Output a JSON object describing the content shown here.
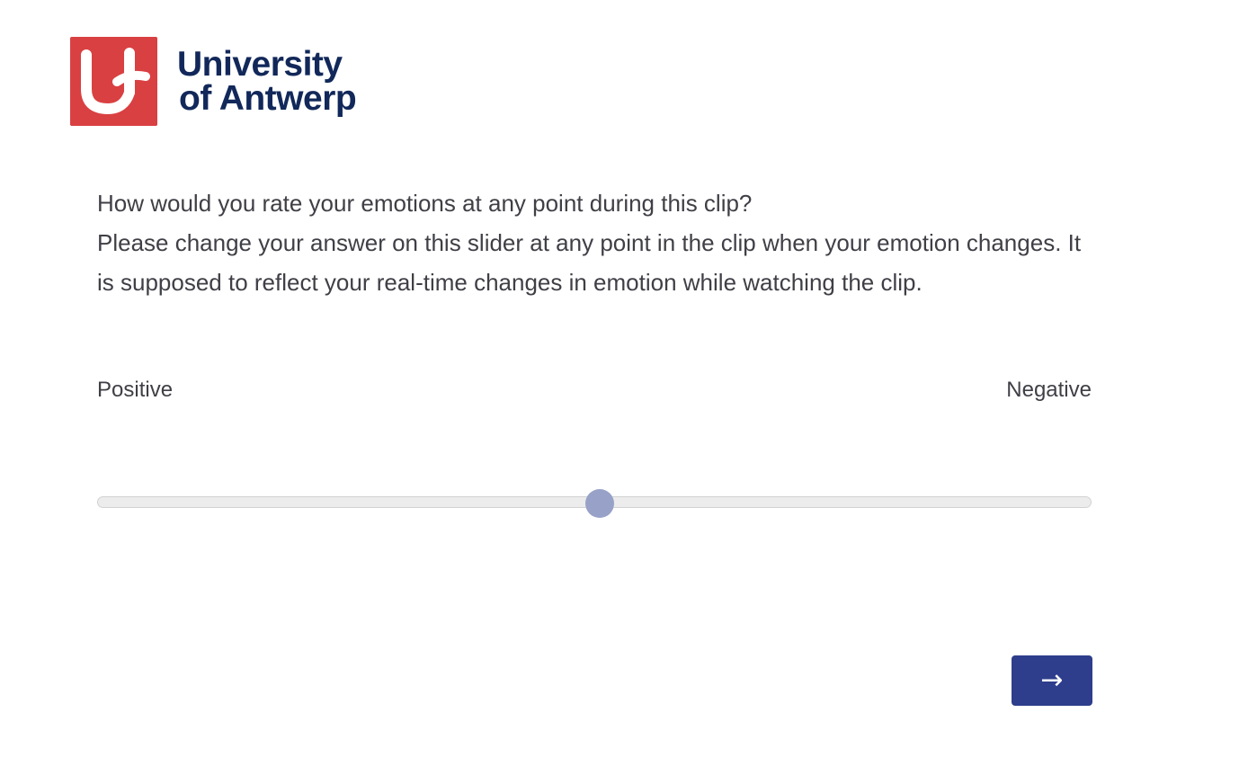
{
  "logo": {
    "line1": "University",
    "line2": "of Antwerp",
    "mark_color": "#d94042",
    "text_color": "#12285a"
  },
  "question": {
    "line1": "How would you rate your emotions at any point during this clip?",
    "line2": "Please change your answer on this slider at any point in the clip when your emotion changes. It is supposed to reflect your real-time changes in emotion while watching the clip."
  },
  "slider": {
    "left_label": "Positive",
    "right_label": "Negative",
    "value_fraction": 0.505,
    "handle_color": "#98a2c8"
  },
  "next_button": {
    "label": "→",
    "color": "#2e3e8c",
    "icon": "arrow-right-icon"
  }
}
